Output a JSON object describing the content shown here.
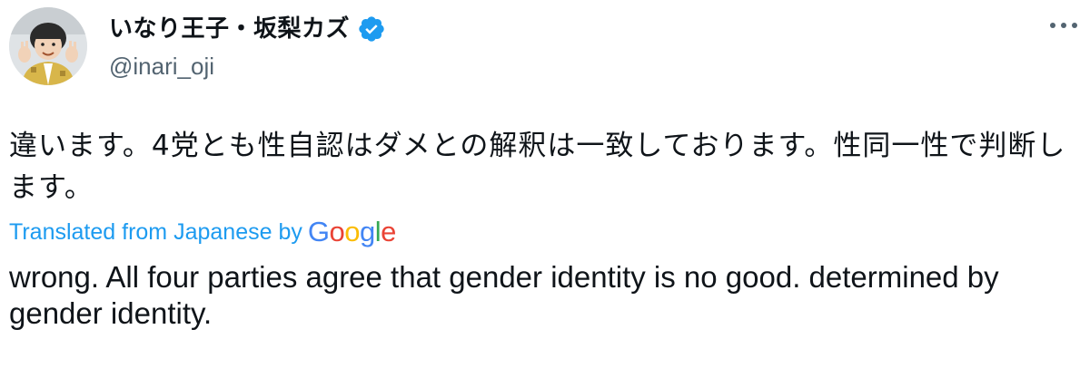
{
  "author": {
    "display_name": "いなり王子・坂梨カズ",
    "handle": "@inari_oji",
    "verified": true,
    "avatar_icon": "profile-photo"
  },
  "tweet": {
    "text_original": "違います。4党とも性自認はダメとの解釈は一致しております。性同一性で判断します。",
    "translation_label": "Translated from Japanese by",
    "translation_provider": {
      "letters": [
        {
          "char": "G",
          "color": "#4285f4"
        },
        {
          "char": "o",
          "color": "#ea4335"
        },
        {
          "char": "o",
          "color": "#fbbc05"
        },
        {
          "char": "g",
          "color": "#4285f4"
        },
        {
          "char": "l",
          "color": "#34a853"
        },
        {
          "char": "e",
          "color": "#ea4335"
        }
      ]
    },
    "text_translated": "wrong. All four parties agree that gender identity is no good. determined by gender identity."
  },
  "colors": {
    "link_blue": "#1d9bf0",
    "secondary_text": "#536471",
    "verified_badge": "#1d9bf0"
  }
}
